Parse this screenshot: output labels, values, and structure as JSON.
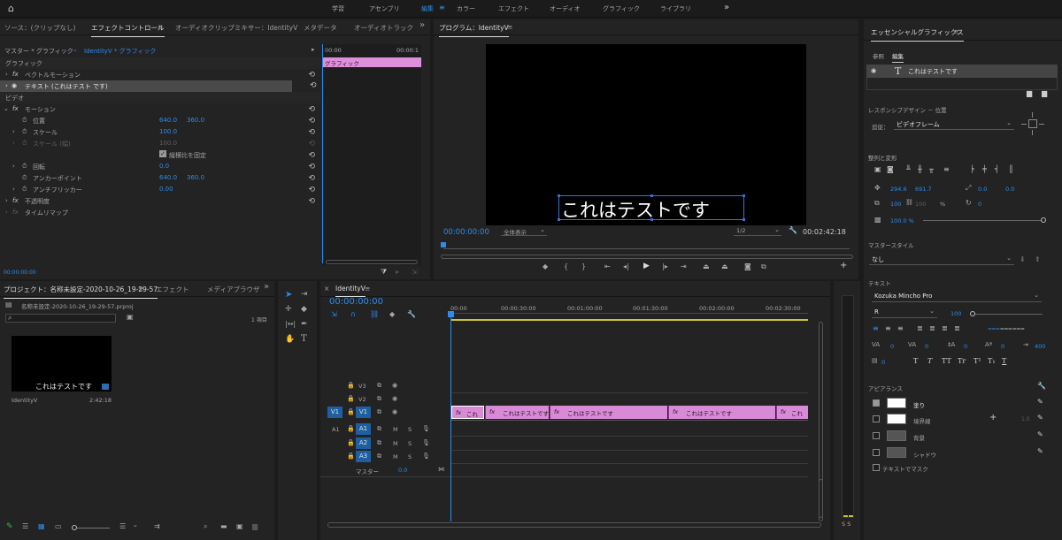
{
  "topbar": {
    "workspaces": [
      "学習",
      "アセンブリ",
      "編集",
      "カラー",
      "エフェクト",
      "オーディオ",
      "グラフィック",
      "ライブラリ"
    ],
    "more": "»"
  },
  "effect_controls": {
    "tabs": [
      "ソース：(クリップなし)",
      "エフェクトコントロール",
      "オーディオクリップミキサー：IdentityV",
      "メタデータ",
      "オーディオトラック"
    ],
    "more": "»",
    "menu_icon": "≡",
    "master_label": "マスター * グラフィック",
    "clip_label": "IdentityV * グラフィック",
    "ruler_start": "00:00",
    "ruler_end": "00:00:1",
    "clip_bar": "グラフィック",
    "section_graphic": "グラフィック",
    "vector_motion": "ベクトルモーション",
    "text_layer": "テキスト (これはテスト です)",
    "section_video": "ビデオ",
    "motion": "モーション",
    "position_label": "位置",
    "position_x": "640.0",
    "position_y": "360.0",
    "scale_label": "スケール",
    "scale_value": "100.0",
    "scale_w_label": "スケール (幅)",
    "scale_w_value": "100.0",
    "uniform_label": "縦横比を固定",
    "rotation_label": "回転",
    "rotation_value": "0.0",
    "anchor_label": "アンカーポイント",
    "anchor_x": "640.0",
    "anchor_y": "360.0",
    "antiflicker_label": "アンチフリッカー",
    "antiflicker_value": "0.00",
    "opacity_label": "不透明度",
    "timeremap_label": "タイムリマップ",
    "timecode": "00:00:00:00"
  },
  "program": {
    "title": "プログラム：IdentityV",
    "menu_icon": "≡",
    "caption": "これはテストです",
    "timecode": "00:00:00:00",
    "fit": "全体表示",
    "resolution": "1/2",
    "duration": "00:02:42:18"
  },
  "essential_graphics": {
    "title": "エッセンシャルグラフィックス",
    "menu_icon": "≡",
    "tab_browse": "参照",
    "tab_edit": "編集",
    "layer_name": "これはテストです",
    "responsive_label": "レスポンシブデザイン － 位置",
    "pin_label": "追従：",
    "pin_value": "ビデオフレーム",
    "align_label": "整列と変形",
    "pos_x": "294.6",
    "pos_y": "691.7",
    "anchor_x": "0.0",
    "anchor_y": "0.0",
    "scale_w": "100",
    "scale_h": "100",
    "scale_unit": "%",
    "rotation": "0",
    "opacity": "100.0 %",
    "master_style_label": "マスタースタイル",
    "master_style_value": "なし",
    "text_label": "テキスト",
    "font": "Kozuka Mincho Pro",
    "font_style": "R",
    "font_size": "100",
    "kerning": "0",
    "tracking": "0",
    "leading": "0",
    "baseline": "0",
    "tsume": "0",
    "tab_width": "400",
    "appearance_label": "アピアランス",
    "fill_label": "塗り",
    "stroke_label": "境界線",
    "stroke_width": "1.0",
    "background_label": "背景",
    "shadow_label": "シャドウ",
    "mask_label": "テキストでマスク"
  },
  "project": {
    "tabs": [
      "プロジェクト：名称未設定-2020-10-26_19-29-57",
      "エフェクト",
      "メディアブラウザ"
    ],
    "more": "»",
    "menu_icon": "≡",
    "file": "名称未設定-2020-10-26_19-29-57.prproj",
    "count": "1 項目",
    "thumb_caption": "これはテストです",
    "item_name": "IdentityV",
    "item_duration": "2:42:18"
  },
  "timeline": {
    "title": "IdentityV",
    "menu_icon": "≡",
    "timecode": "00:00:00:00",
    "ruler": [
      "00:00",
      "00:00:30:00",
      "00:01:00:00",
      "00:01:30:00",
      "00:02:00:00",
      "00:02:30:00"
    ],
    "video_tracks": [
      "V3",
      "V2",
      "V1"
    ],
    "audio_tracks": [
      "A1",
      "A2",
      "A3"
    ],
    "source_v": "V1",
    "source_a": "A1",
    "master_label": "マスター",
    "master_value": "0.0",
    "clips": [
      "これ",
      "これはテストです",
      "これはテストです",
      "これはテストです",
      "これ"
    ],
    "mute": "M",
    "solo": "S",
    "meter_labels": "S S"
  }
}
